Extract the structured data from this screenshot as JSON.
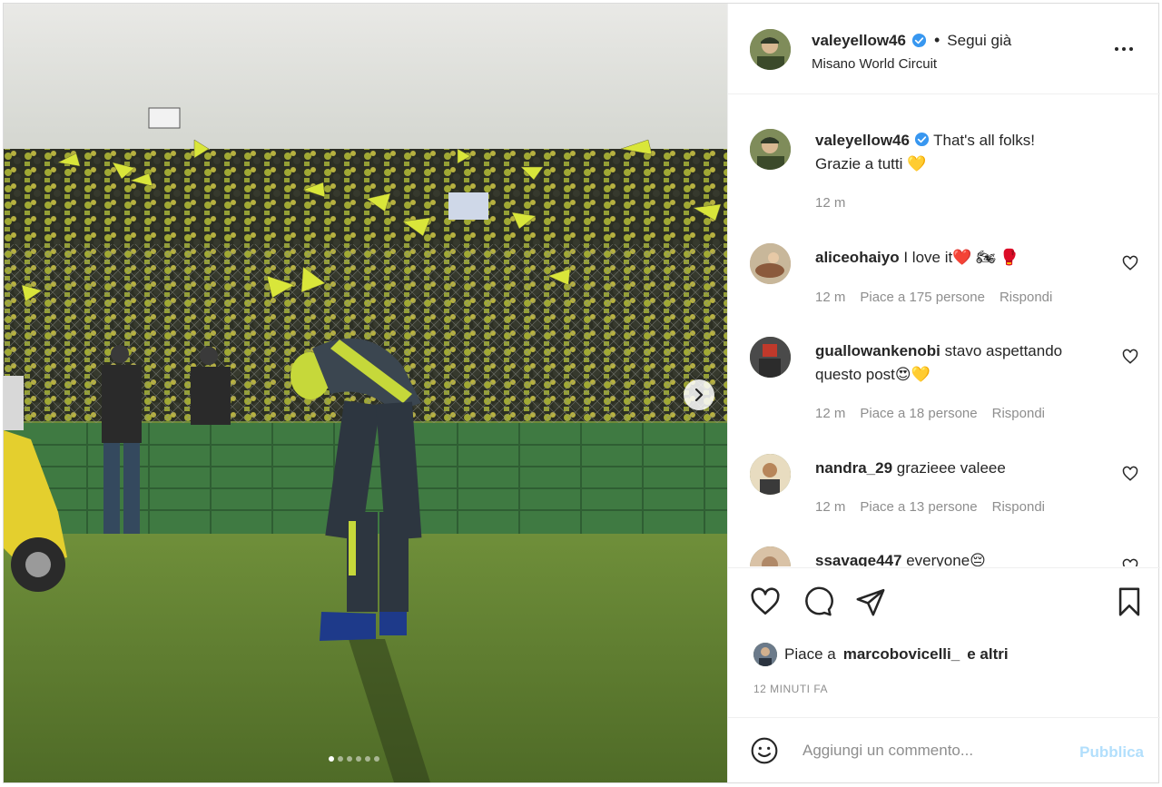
{
  "post": {
    "author": "valeyellow46",
    "separator": "•",
    "follow_status": "Segui già",
    "location": "Misano World Circuit",
    "more_icon": "more-horizontal-icon"
  },
  "caption": {
    "username": "valeyellow46",
    "text_line1": "That's all folks!",
    "text_line2": "Grazie a tutti 💛",
    "time": "12 m"
  },
  "comments": [
    {
      "username": "aliceohaiyo",
      "text": "I love it❤️ 🏍 🥊",
      "time": "12 m",
      "likes": "Piace a 175 persone",
      "reply": "Rispondi"
    },
    {
      "username": "guallowankenobi",
      "text_line1": "stavo aspettando",
      "text_line2": "questo post😍💛",
      "time": "12 m",
      "likes": "Piace a 18 persone",
      "reply": "Rispondi"
    },
    {
      "username": "nandra_29",
      "text": "grazieee valeee",
      "time": "12 m",
      "likes": "Piace a 13 persone",
      "reply": "Rispondi"
    },
    {
      "username": "ssavage447",
      "text": "everyone😔"
    }
  ],
  "actions": {
    "icons": [
      "heart-icon",
      "comment-icon",
      "share-icon",
      "bookmark-icon"
    ],
    "liked_by_prefix": "Piace a",
    "liked_by_user": "marcobovicelli_",
    "liked_by_suffix": "e altri",
    "timestamp": "12 MINUTI FA"
  },
  "add_comment": {
    "placeholder": "Aggiungi un commento...",
    "publish_label": "Pubblica"
  },
  "carousel": {
    "slide_count": 6,
    "active_slide": 1
  },
  "colors": {
    "verified": "#3897f0",
    "muted": "#8e8e8e",
    "publish_disabled": "#b2dffc",
    "heart": "#ed4956"
  }
}
